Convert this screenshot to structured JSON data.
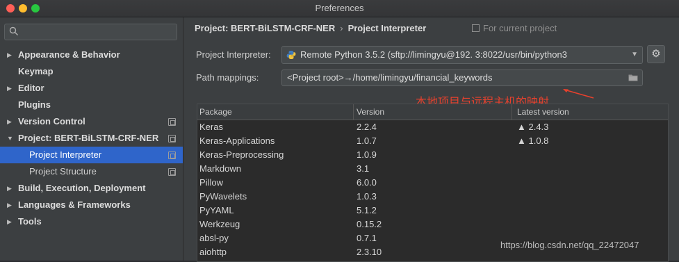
{
  "window": {
    "title": "Preferences"
  },
  "search": {
    "placeholder": ""
  },
  "sidebar": {
    "items": [
      {
        "label": "Appearance & Behavior",
        "arrow": "▶"
      },
      {
        "label": "Keymap",
        "arrow": ""
      },
      {
        "label": "Editor",
        "arrow": "▶"
      },
      {
        "label": "Plugins",
        "arrow": ""
      },
      {
        "label": "Version Control",
        "arrow": "▶"
      },
      {
        "label": "Project: BERT-BiLSTM-CRF-NER",
        "arrow": "▼"
      },
      {
        "label": "Project Interpreter",
        "arrow": ""
      },
      {
        "label": "Project Structure",
        "arrow": ""
      },
      {
        "label": "Build, Execution, Deployment",
        "arrow": "▶"
      },
      {
        "label": "Languages & Frameworks",
        "arrow": "▶"
      },
      {
        "label": "Tools",
        "arrow": "▶"
      }
    ]
  },
  "breadcrumb": {
    "project": "Project: BERT-BiLSTM-CRF-NER",
    "separator": "›",
    "page": "Project Interpreter",
    "scope": "For current project"
  },
  "interpreter": {
    "label": "Project Interpreter:",
    "value": "Remote Python 3.5.2 (sftp://limingyu@192.             3:8022/usr/bin/python3"
  },
  "path_mappings": {
    "label": "Path mappings:",
    "value": "<Project root>→/home/limingyu/financial_keywords"
  },
  "annotation": {
    "text": "本地项目与远程主机的映射",
    "color": "#e8412d"
  },
  "table": {
    "headers": [
      "Package",
      "Version",
      "Latest version"
    ],
    "rows": [
      {
        "package": "Keras",
        "version": "2.2.4",
        "latest": "▲ 2.4.3"
      },
      {
        "package": "Keras-Applications",
        "version": "1.0.7",
        "latest": "▲ 1.0.8"
      },
      {
        "package": "Keras-Preprocessing",
        "version": "1.0.9",
        "latest": ""
      },
      {
        "package": "Markdown",
        "version": "3.1",
        "latest": ""
      },
      {
        "package": "Pillow",
        "version": "6.0.0",
        "latest": ""
      },
      {
        "package": "PyWavelets",
        "version": "1.0.3",
        "latest": ""
      },
      {
        "package": "PyYAML",
        "version": "5.1.2",
        "latest": ""
      },
      {
        "package": "Werkzeug",
        "version": "0.15.2",
        "latest": ""
      },
      {
        "package": "absl-py",
        "version": "0.7.1",
        "latest": ""
      },
      {
        "package": "aiohttp",
        "version": "2.3.10",
        "latest": ""
      }
    ]
  },
  "watermark": {
    "text": "https://blog.csdn.net/qq_22472047"
  },
  "colors": {
    "selection": "#2f65ca",
    "background": "#3c3f41",
    "table_bg": "#2b2b2b"
  }
}
